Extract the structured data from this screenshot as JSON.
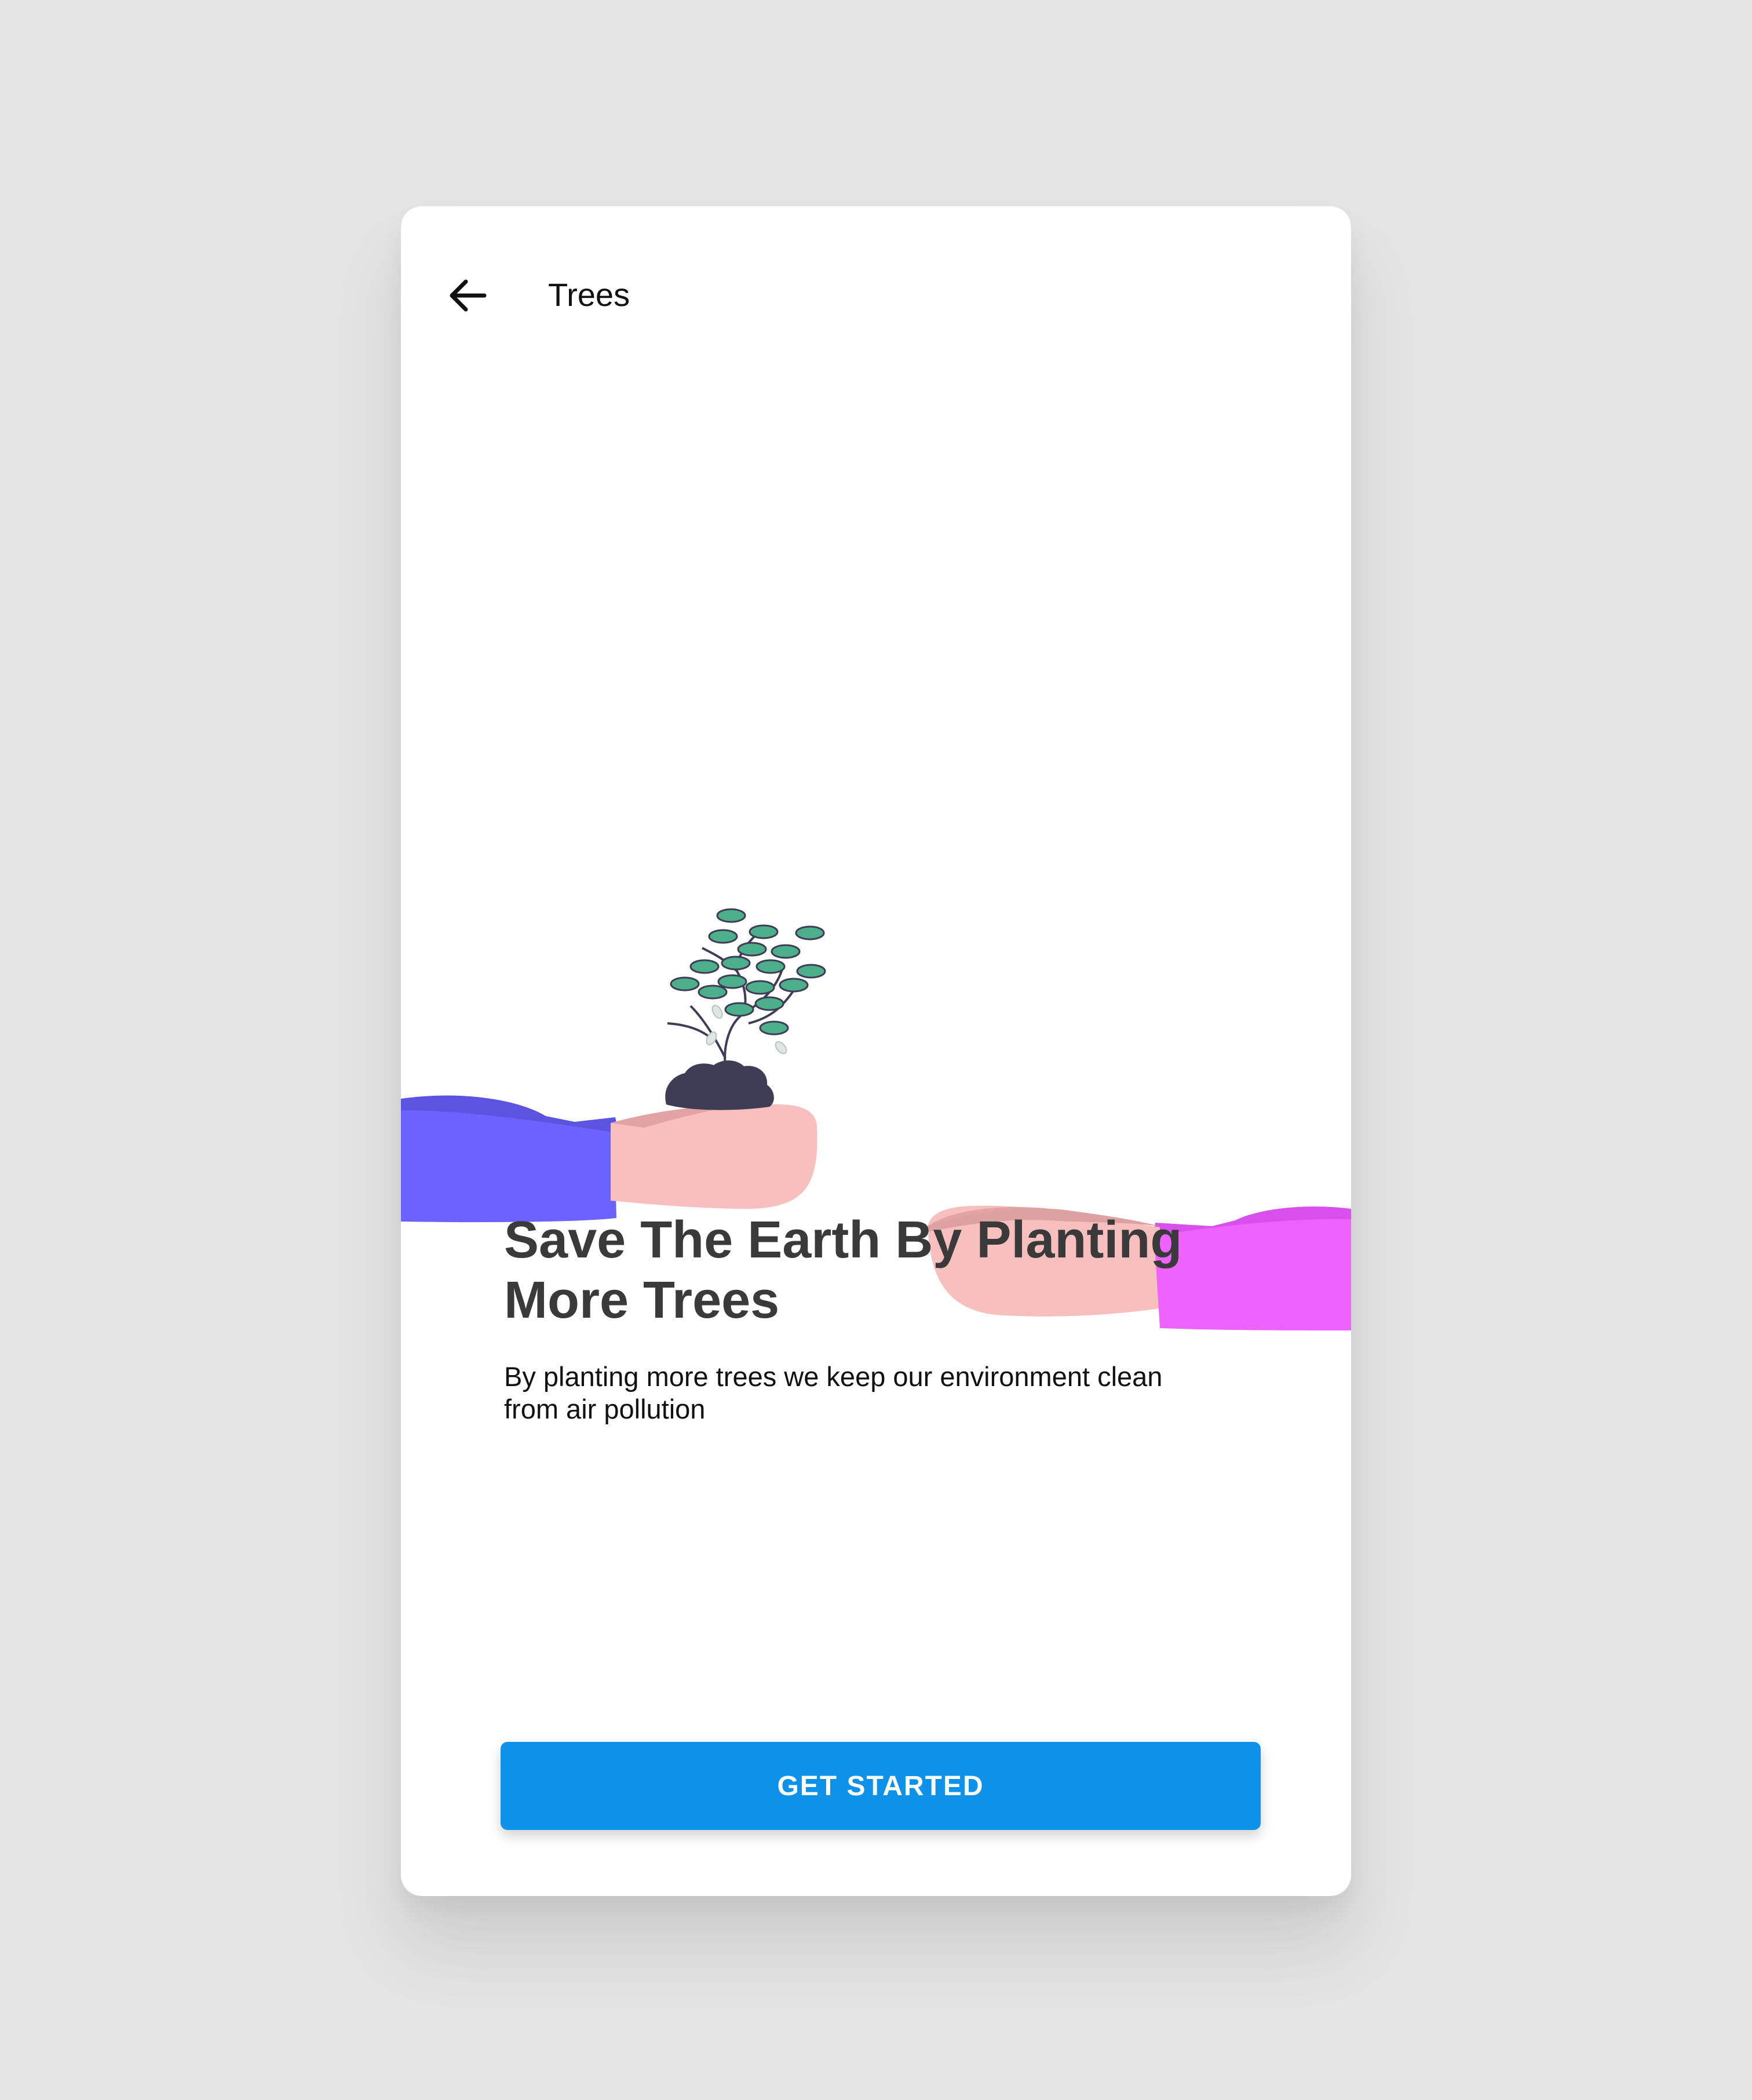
{
  "header": {
    "back_icon": "arrow-left-icon",
    "title": "Trees"
  },
  "illustration": {
    "icon": "hands-passing-sapling-illustration",
    "colors": {
      "left_sleeve": "#6c63ff",
      "right_sleeve": "#ee62ff",
      "skin": "#f8bfbf",
      "soil": "#3f3d56",
      "leaf": "#4caf8c"
    }
  },
  "content": {
    "headline": "Save The Earth By Planting More Trees",
    "description": "By planting more trees we keep our environment clean from air pollution"
  },
  "cta": {
    "label": "GET STARTED",
    "color": "#0d91e9"
  },
  "colors": {
    "background": "#e4e4e4",
    "card": "#ffffff"
  }
}
